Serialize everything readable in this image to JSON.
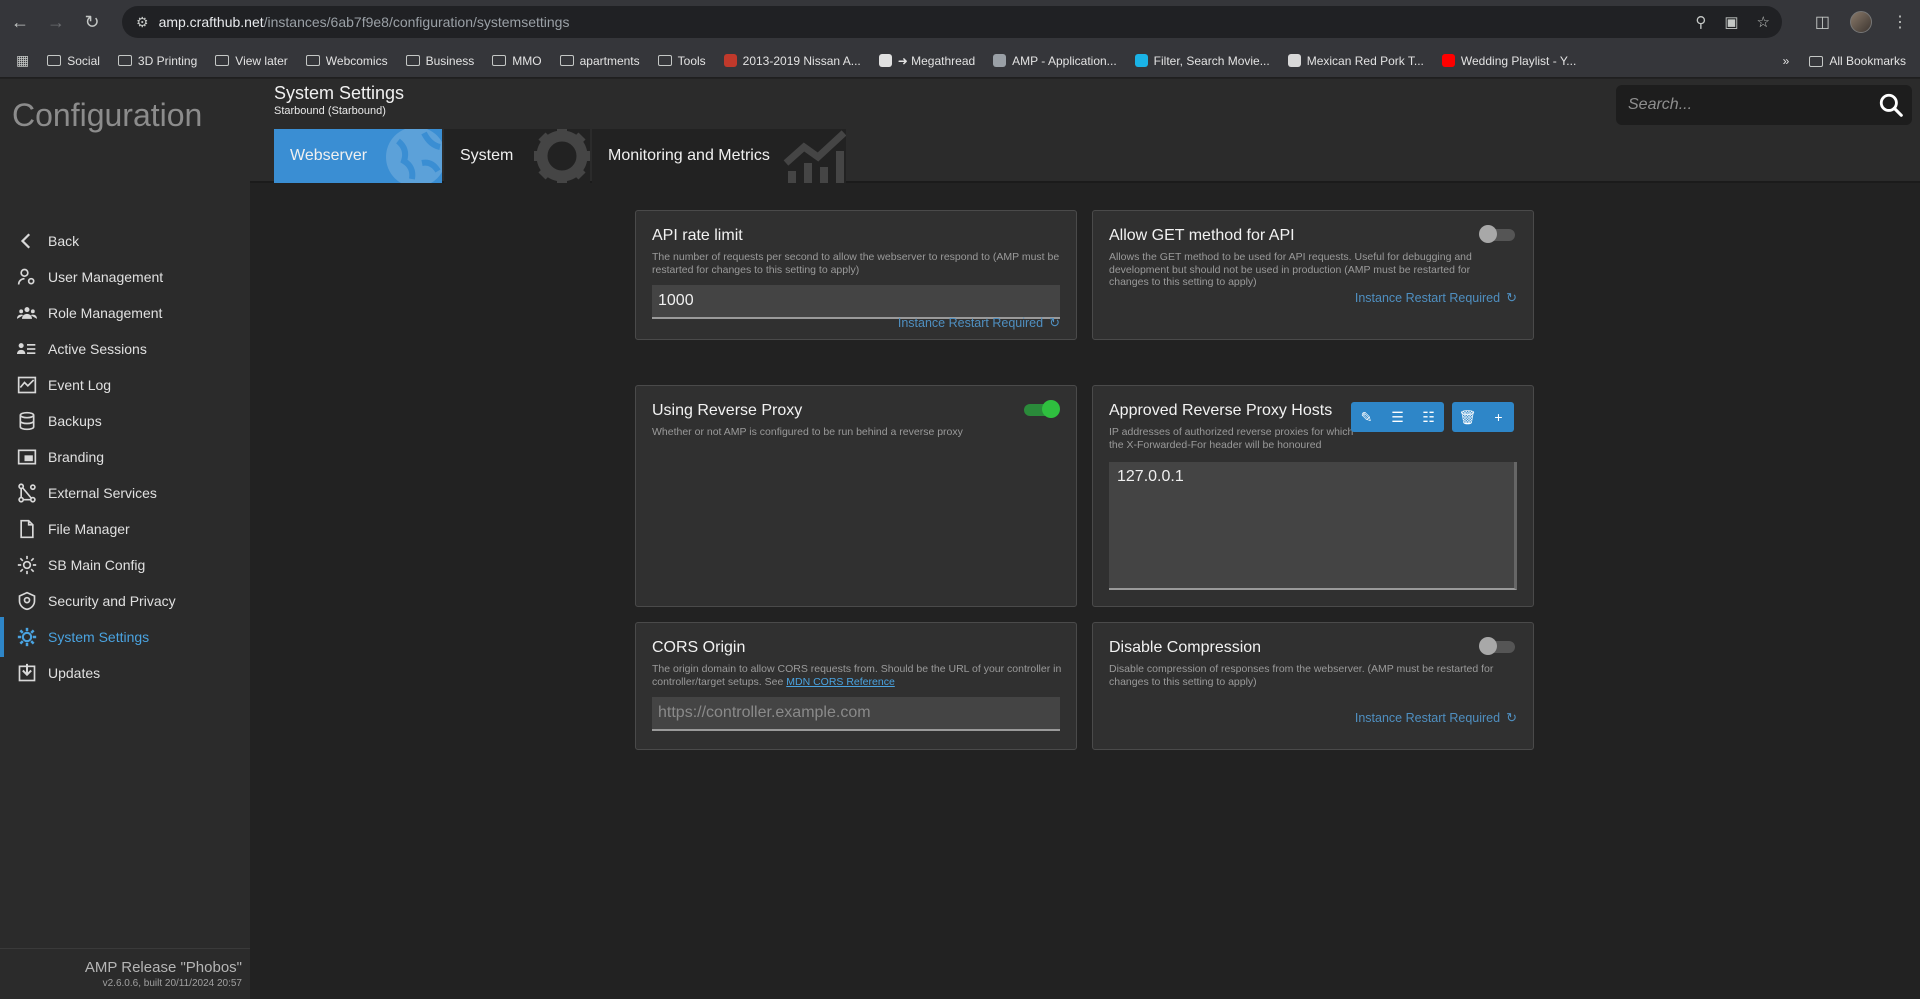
{
  "browser": {
    "url_host": "amp.crafthub.net",
    "url_path": "/instances/6ab7f9e8/configuration/systemsettings",
    "bookmarks": [
      {
        "label": "Social",
        "type": "folder"
      },
      {
        "label": "3D Printing",
        "type": "folder"
      },
      {
        "label": "View later",
        "type": "folder"
      },
      {
        "label": "Webcomics",
        "type": "folder"
      },
      {
        "label": "Business",
        "type": "folder"
      },
      {
        "label": "MMO",
        "type": "folder"
      },
      {
        "label": "apartments",
        "type": "folder"
      },
      {
        "label": "Tools",
        "type": "folder"
      },
      {
        "label": "2013-2019 Nissan A...",
        "type": "site",
        "color": "#c0392b"
      },
      {
        "label": "➜ Megathread",
        "type": "site",
        "color": "#e0e0e0"
      },
      {
        "label": "AMP - Application...",
        "type": "site",
        "color": "#9aa0a6"
      },
      {
        "label": "Filter, Search Movie...",
        "type": "site",
        "color": "#1ab3e6"
      },
      {
        "label": "Mexican Red Pork T...",
        "type": "site",
        "color": "#d8d8d8"
      },
      {
        "label": "Wedding Playlist - Y...",
        "type": "site",
        "color": "#ff0000"
      }
    ],
    "more_label": "»",
    "all_bookmarks": "All Bookmarks"
  },
  "sidebar": {
    "title": "Configuration",
    "items": [
      {
        "label": "Back",
        "icon": "chevron-left-icon"
      },
      {
        "label": "User Management",
        "icon": "user-gear-icon"
      },
      {
        "label": "Role Management",
        "icon": "users-icon"
      },
      {
        "label": "Active Sessions",
        "icon": "sessions-list-icon"
      },
      {
        "label": "Event Log",
        "icon": "chart-log-icon"
      },
      {
        "label": "Backups",
        "icon": "database-icon"
      },
      {
        "label": "Branding",
        "icon": "branding-window-icon"
      },
      {
        "label": "External Services",
        "icon": "services-nodes-icon"
      },
      {
        "label": "File Manager",
        "icon": "file-icon"
      },
      {
        "label": "SB Main Config",
        "icon": "config-gear-icon"
      },
      {
        "label": "Security and Privacy",
        "icon": "shield-icon"
      },
      {
        "label": "System Settings",
        "icon": "gear-icon"
      },
      {
        "label": "Updates",
        "icon": "download-icon"
      }
    ],
    "active_index": 11,
    "release": "AMP Release \"Phobos\"",
    "build": "v2.6.0.6, built 20/11/2024 20:57"
  },
  "header": {
    "title": "System Settings",
    "subtitle": "Starbound (Starbound)",
    "search_placeholder": "Search...",
    "tabs": [
      {
        "label": "Webserver",
        "icon": "globe-icon",
        "active": true
      },
      {
        "label": "System",
        "icon": "gear-icon",
        "active": false
      },
      {
        "label": "Monitoring and Metrics",
        "icon": "chart-icon",
        "active": false
      }
    ]
  },
  "settings": {
    "api_rate_limit": {
      "title": "API rate limit",
      "description": "The number of requests per second to allow the webserver to respond to (AMP must be restarted for changes to this setting to apply)",
      "value": "1000",
      "restart_label": "Instance Restart Required"
    },
    "allow_get": {
      "title": "Allow GET method for API",
      "description": "Allows the GET method to be used for API requests. Useful for debugging and development but should not be used in production (AMP must be restarted for changes to this setting to apply)",
      "enabled": false,
      "restart_label": "Instance Restart Required"
    },
    "reverse_proxy": {
      "title": "Using Reverse Proxy",
      "description": "Whether or not AMP is configured to be run behind a reverse proxy",
      "enabled": true
    },
    "approved_hosts": {
      "title": "Approved Reverse Proxy Hosts",
      "description": "IP addresses of authorized reverse proxies for which the X-Forwarded-For header will be honoured",
      "value": "127.0.0.1"
    },
    "cors_origin": {
      "title": "CORS Origin",
      "description": "The origin domain to allow CORS requests from. Should be the URL of your controller in controller/target setups. See ",
      "link_text": "MDN CORS Reference",
      "placeholder": "https://controller.example.com"
    },
    "disable_compression": {
      "title": "Disable Compression",
      "description": "Disable compression of responses from the webserver. (AMP must be restarted for changes to this setting to apply)",
      "enabled": false,
      "restart_label": "Instance Restart Required"
    }
  },
  "colors": {
    "accent": "#3a8ed3",
    "toggle_on": "#2fbf3f",
    "restart_link": "#4f8fc0"
  }
}
